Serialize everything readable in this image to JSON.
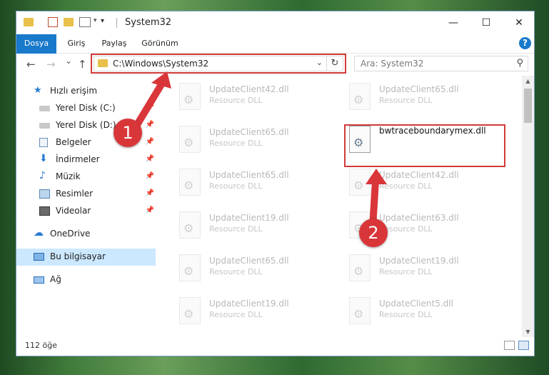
{
  "window": {
    "title": "System32"
  },
  "ribbon": {
    "tabs": [
      "Dosya",
      "Giriş",
      "Paylaş",
      "Görünüm"
    ],
    "help": "?"
  },
  "navbar": {
    "back": "←",
    "forward": "→",
    "recent": "⌄",
    "up": "↑",
    "address": "C:\\Windows\\System32",
    "search_placeholder": "Ara: System32"
  },
  "sidebar": {
    "items": [
      {
        "label": "Hızlı erişim",
        "icon": "star-icon"
      },
      {
        "label": "Yerel Disk (C:)",
        "icon": "drive-icon"
      },
      {
        "label": "Yerel Disk (D:)",
        "icon": "drive-icon"
      },
      {
        "label": "Belgeler",
        "icon": "documents-icon"
      },
      {
        "label": "İndirmeler",
        "icon": "download-icon"
      },
      {
        "label": "Müzik",
        "icon": "music-icon"
      },
      {
        "label": "Resimler",
        "icon": "pictures-icon"
      },
      {
        "label": "Videolar",
        "icon": "videos-icon"
      },
      {
        "label": "OneDrive",
        "icon": "cloud-icon"
      },
      {
        "label": "Bu bilgisayar",
        "icon": "computer-icon"
      },
      {
        "label": "Ağ",
        "icon": "network-icon"
      }
    ]
  },
  "files": {
    "left": [
      {
        "name": "UpdateClient42.dll",
        "type": "Resource DLL"
      },
      {
        "name": "UpdateClient65.dll",
        "type": "Resource DLL"
      },
      {
        "name": "UpdateClient65.dll",
        "type": "Resource DLL"
      },
      {
        "name": "UpdateClient19.dll",
        "type": "Resource DLL"
      },
      {
        "name": "UpdateClient65.dll",
        "type": "Resource DLL"
      },
      {
        "name": "UpdateClient19.dll",
        "type": "Resource DLL"
      }
    ],
    "right": [
      {
        "name": "UpdateClient65.dll",
        "type": "Resource DLL"
      },
      {
        "name": "bwtraceboundarymex.dll",
        "type": ""
      },
      {
        "name": "UpdateClient42.dll",
        "type": "Resource DLL"
      },
      {
        "name": "UpdateClient63.dll",
        "type": "Resource DLL"
      },
      {
        "name": "UpdateClient19.dll",
        "type": "Resource DLL"
      },
      {
        "name": "UpdateClient5.dll",
        "type": "Resource DLL"
      }
    ]
  },
  "status": {
    "count": "112 öğe"
  },
  "annotations": {
    "badge1": "1",
    "badge2": "2",
    "color": "#d9363a"
  }
}
